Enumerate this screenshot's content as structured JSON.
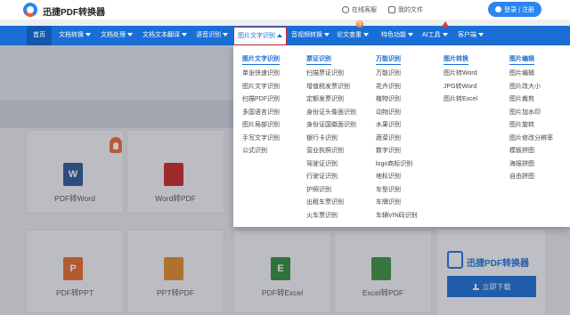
{
  "header": {
    "brand": "迅捷PDF转换器",
    "support_link": "在线客服",
    "files_link": "我的文件",
    "login_label": "登录 | 注册"
  },
  "nav": {
    "items": [
      {
        "label": "首页"
      },
      {
        "label": "文档转换"
      },
      {
        "label": "文档处理"
      },
      {
        "label": "文档文本翻译"
      },
      {
        "label": "语音识别"
      },
      {
        "label": "图片文字识别"
      },
      {
        "label": "音视频转换"
      },
      {
        "label": "论文查重"
      },
      {
        "label": "特色功能"
      },
      {
        "label": "AI工具"
      },
      {
        "label": "客户端"
      }
    ],
    "badge_text": "荐"
  },
  "dropdown": {
    "columns": [
      {
        "title": "图片文字识别",
        "items": [
          "单张快速识别",
          "图片文字识别",
          "扫描PDF识别",
          "多国语言识别",
          "图片局部识别",
          "手写文字识别",
          "公式识别"
        ]
      },
      {
        "title": "票证识别",
        "items": [
          "扫描票证识别",
          "增值税发票识别",
          "定额发票识别",
          "身份证头像面识别",
          "身份证国徽面识别",
          "银行卡识别",
          "营业执照识别",
          "驾驶证识别",
          "行驶证识别",
          "护照识别",
          "出租车票识别",
          "火车票识别"
        ]
      },
      {
        "title": "万能识别",
        "items": [
          "万能识别",
          "花卉识别",
          "植物识别",
          "动物识别",
          "水果识别",
          "蔬菜识别",
          "数字识别",
          "logo商标识别",
          "地标识别",
          "车型识别",
          "车牌识别",
          "车辆VIN码识别"
        ]
      },
      {
        "title": "图片转换",
        "items": [
          "图片转Word",
          "JPG转Word",
          "图片转Excel"
        ]
      },
      {
        "title": "图片编辑",
        "items": [
          "图片编辑",
          "图片改大小",
          "图片裁剪",
          "图片加水印",
          "图片旋转",
          "图片修改分辨率",
          "模板拼图",
          "海报拼图",
          "自由拼图"
        ]
      }
    ]
  },
  "cards": [
    {
      "label": "PDF转Word",
      "icon": "W",
      "color": "#2b5797"
    },
    {
      "label": "Word转PDF",
      "icon": "",
      "color": "#c62828"
    },
    {
      "label": "PDF转PPT",
      "icon": "P",
      "color": "#e66a2c"
    },
    {
      "label": "PPT转PDF",
      "icon": "",
      "color": "#e08a2a"
    },
    {
      "label": "PDF转Excel",
      "icon": "E",
      "color": "#2e8b3e"
    },
    {
      "label": "Excel转PDF",
      "icon": "",
      "color": "#3f8f3f"
    }
  ],
  "promo": {
    "brand": "迅捷PDF转换器",
    "download_label": "立即下载"
  },
  "colors": {
    "accent": "#1a6fd6",
    "nav_bg": "#1a6fd6",
    "active_border": "#c62828"
  }
}
